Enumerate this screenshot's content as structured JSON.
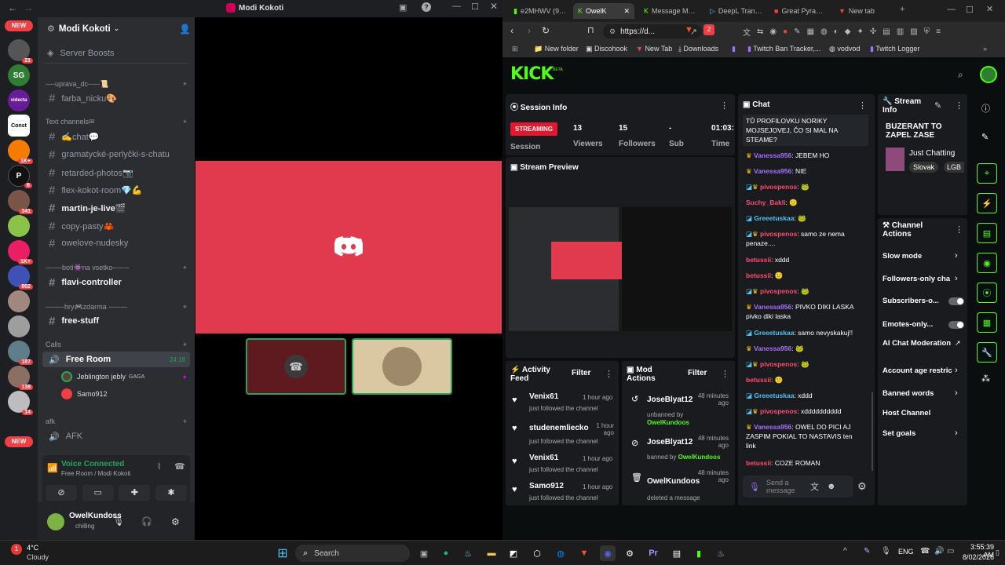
{
  "discord": {
    "window_title": "Modi Kokoti",
    "server_name": "Modi Kokoti",
    "server_boosts": "Server Boosts",
    "guild_badges": {
      "new": "NEW",
      "b1": "21",
      "b2": "1K+",
      "b3": "6",
      "b4": "341",
      "b5": "1K+",
      "b6": "802",
      "b7": "187",
      "b8": "138",
      "b9": "14"
    },
    "guild_labels": {
      "const": "Const",
      "vd": "videcta"
    },
    "cat1": "----uprava_dc-----📜",
    "ch_farba": "farba_nicku🎨",
    "cat_text": "Text channels✉",
    "ch_chat": "✍chat💬",
    "ch_gram": "gramatycké-perlyčki-s-chatu",
    "ch_ret": "retarded-photos📷",
    "ch_flex": "flex-kokot-room💎💪",
    "ch_martin": "martin-je-live🎬",
    "ch_copy": "copy-pasty🦀",
    "ch_owel": "owelove-nudesky",
    "cat_boti": "-------boti👾na vsetko-------",
    "ch_flavi": "flavi-controller",
    "cat_hry": "--------hry🎮zdarma --------",
    "ch_free": "free-stuff",
    "cat_calls": "Calls",
    "voice_room": "Free Room",
    "voice_time": "24:18",
    "user1": "Jeblington jebly",
    "user1_tag": "GAGA",
    "user2": "Samo912",
    "cat_afk": "afk",
    "ch_afk": "AFK",
    "voice_status": "Voice Connected",
    "voice_sub": "Free Room / Modi Kokoti",
    "me_name": "OwelKundoss",
    "me_status": "chilling"
  },
  "browser": {
    "tabs": [
      "e2MHWV (94...",
      "OwelK",
      "Message Mo...",
      "DeepL Transl...",
      "Great Pyrami...",
      "New tab"
    ],
    "url": "https://d...",
    "ext_badge": "2",
    "bookmarks": [
      "New folder",
      "Discohook",
      "New Tab",
      "Downloads",
      "Twitch Ban Tracker,...",
      "vodvod",
      "Twitch Logger"
    ],
    "logo": "KICK",
    "logo_beta": "BETA",
    "session": {
      "title": "Session Info",
      "streaming": "STREAMING",
      "session_label": "Session",
      "viewers": "13",
      "viewers_label": "Viewers",
      "followers": "15",
      "followers_label": "Followers",
      "sub": "-",
      "sub_label": "Sub",
      "time": "01:03:",
      "time_label": "Time"
    },
    "preview_title": "Stream Preview",
    "activity": {
      "title": "Activity Feed",
      "filter": "Filter",
      "items": [
        {
          "name": "Venix61",
          "time": "1 hour ago",
          "desc": "just followed the channel"
        },
        {
          "name": "studenemliecko",
          "time": "1 hour ago",
          "desc": "just followed the channel"
        },
        {
          "name": "Venix61",
          "time": "1 hour ago",
          "desc": "just followed the channel"
        },
        {
          "name": "Samo912",
          "time": "1 hour ago",
          "desc": "just followed the channel"
        }
      ]
    },
    "mod": {
      "title": "Mod Actions",
      "filter": "Filter",
      "items": [
        {
          "name": "JoseBlyat12",
          "time": "48 minutes ago",
          "desc": "unbanned by",
          "by": "OwelKundoos"
        },
        {
          "name": "JoseBlyat12",
          "time": "48 minutes ago",
          "desc": "banned by",
          "by": "OwelKundoos"
        },
        {
          "name": "OwelKundoos",
          "time": "48 minutes ago",
          "desc": "deleted a message",
          "by": ""
        }
      ]
    },
    "chat": {
      "title": "Chat",
      "send_placeholder": "Send a message",
      "lines": [
        {
          "u": "",
          "c": "#fff",
          "m": "TŮ PROFILOVKU NORIKY MOJSEJOVEJ, ČO SI MAL NA STEAME?"
        },
        {
          "u": "Vanessa956",
          "c": "#a970ff",
          "m": ": JEBEM HO"
        },
        {
          "u": "Vanessa956",
          "c": "#a970ff",
          "m": ": NIE"
        },
        {
          "u": "pivospenos",
          "c": "#ff4d6d",
          "m": ": 🐸"
        },
        {
          "u": "Suchy_Bakli",
          "c": "#ff4d6d",
          "m": ": 🙂"
        },
        {
          "u": "Greeetuskaa",
          "c": "#4fc3f7",
          "m": ": 🐸"
        },
        {
          "u": "pivospenos",
          "c": "#ff4d6d",
          "m": ": samo ze nema penaze...."
        },
        {
          "u": "betussii",
          "c": "#ff4d6d",
          "m": ": xddd"
        },
        {
          "u": "betussii",
          "c": "#ff4d6d",
          "m": ": 🙂"
        },
        {
          "u": "pivospenos",
          "c": "#ff4d6d",
          "m": ": 🐸"
        },
        {
          "u": "Vanessa956",
          "c": "#a970ff",
          "m": ": PIVKO DIKI LASKA pivko diki laska"
        },
        {
          "u": "Greeetuskaa",
          "c": "#4fc3f7",
          "m": ": samo nevyskakuj!!"
        },
        {
          "u": "Vanessa956",
          "c": "#a970ff",
          "m": ": 🐸"
        },
        {
          "u": "pivospenos",
          "c": "#ff4d6d",
          "m": ": 🐸"
        },
        {
          "u": "betussii",
          "c": "#ff4d6d",
          "m": ": 🙂"
        },
        {
          "u": "Greeetuskaa",
          "c": "#4fc3f7",
          "m": ": xddd"
        },
        {
          "u": "pivospenos",
          "c": "#ff4d6d",
          "m": ": xdddddddddd"
        },
        {
          "u": "Vanessa956",
          "c": "#a970ff",
          "m": ": OWEL DO PICI AJ ZASPIM POKIAL TO NASTAVIS ten link"
        },
        {
          "u": "betussii",
          "c": "#ff4d6d",
          "m": ": COZE ROMAN"
        }
      ]
    },
    "stream_info": {
      "title": "Stream Info",
      "stream_title": "BUZERANT TO ZAPEL ZASE",
      "category": "Just Chatting",
      "tag1": "Slovak",
      "tag2": "LGB"
    },
    "channel_actions": {
      "title": "Channel Actions",
      "items": [
        "Slow mode",
        "Followers-only cha",
        "Subscribers-o...",
        "Emotes-only...",
        "AI Chat Moderation",
        "Account age restric",
        "Banned words",
        "Host Channel",
        "Set goals"
      ]
    }
  },
  "taskbar": {
    "temp": "4°C",
    "weather": "Cloudy",
    "search": "Search",
    "lang": "ENG",
    "time": "3:55:39 AM",
    "date": "8/02/2026"
  }
}
